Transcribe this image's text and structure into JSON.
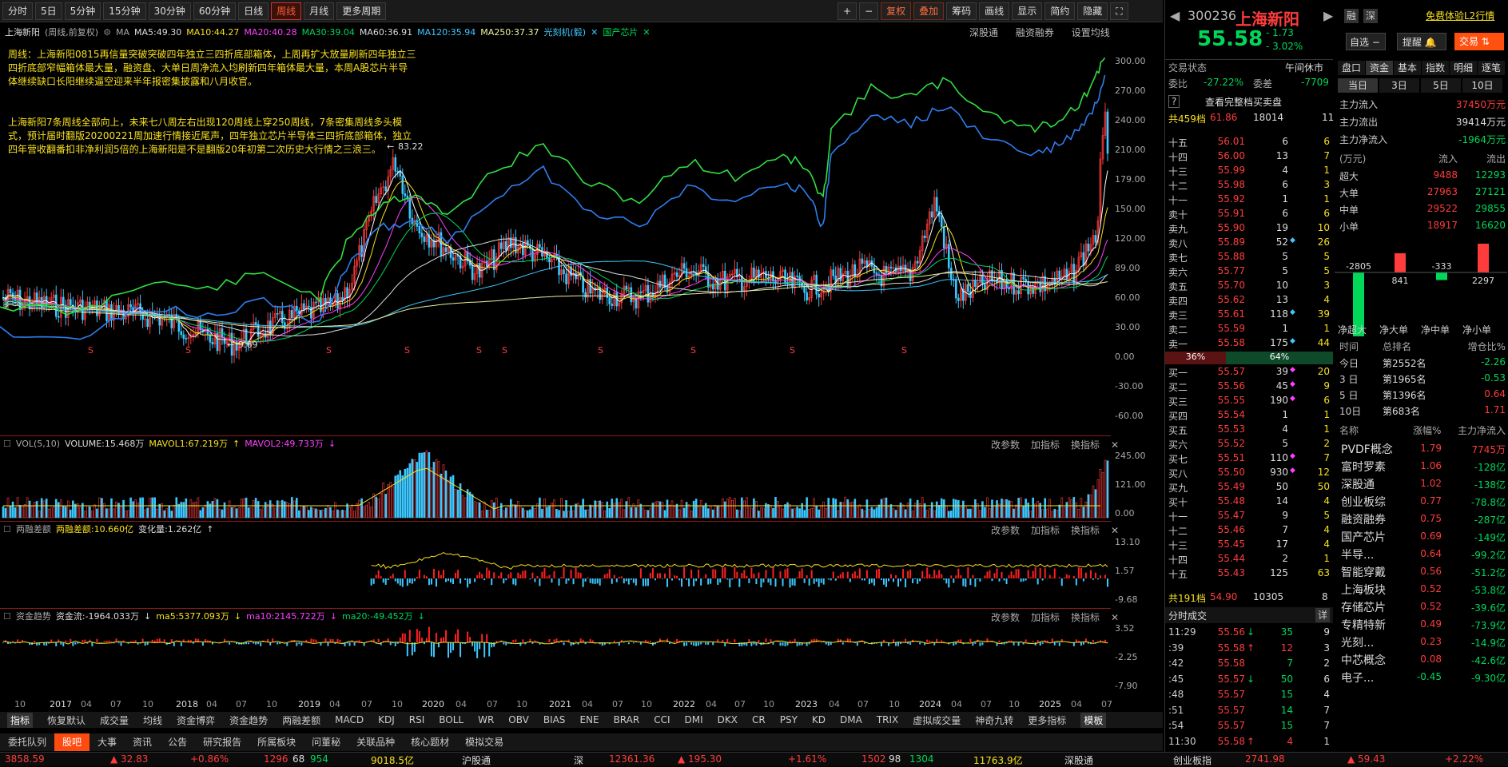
{
  "toolbar": {
    "items": [
      "分时",
      "5日",
      "5分钟",
      "15分钟",
      "30分钟",
      "60分钟",
      "日线",
      "周线",
      "月线",
      "更多周期"
    ],
    "active": "周线",
    "right_items": [
      "+",
      "−",
      "复权",
      "叠加",
      "筹码",
      "画线",
      "显示",
      "简约",
      "隐藏"
    ]
  },
  "info": {
    "title": "上海新阳",
    "period": "(周线,前复权)",
    "ma_label": "MA",
    "ma5": "MA5:49.30",
    "ma10": "MA10:44.27",
    "ma20": "MA20:40.28",
    "ma30": "MA30:39.04",
    "ma60": "MA60:36.91",
    "ma120": "MA120:35.94",
    "ma250": "MA250:37.37",
    "overlay1": "光刻机(毅)",
    "overlay2": "国产芯片",
    "right_links": [
      "深股通",
      "融资融券",
      "设置均线"
    ]
  },
  "notes": {
    "p1": "周线：上海新阳0815再信量突破突破四年独立三四折底部箱体，上周再扩大放量刷新四年独立三四折底部窄幅箱体最大量，融资盘、大单日周净流入均刷新四年箱体最大量，本周A股芯片半导体继续缺口长阳继续逼空迎来半年报密集披露和八月收官。",
    "p2": "上海新阳7条周线全部向上，未来七八周左右出现120周线上穿250周线，7条密集周线多头模式，预计届时翻版20200221周加速行情接近尾声，四年独立芯片半导体三四折底部箱体，独立四年营收翻番扣非净利润5倍的上海新阳是不是翻版20年初第二次历史大行情之三浪三。"
  },
  "main_axis": [
    "300.00",
    "270.00",
    "240.00",
    "210.00",
    "179.00",
    "150.00",
    "120.00",
    "89.00",
    "60.00",
    "30.00",
    "0.00",
    "-30.00",
    "-60.00"
  ],
  "annotations": {
    "high": "83.22",
    "low": "9.69"
  },
  "vol": {
    "name": "VOL(5,10)",
    "volume": "VOLUME:15.468万",
    "mavol1": "MAVOL1:67.219万",
    "mavol2": "MAVOL2:49.733万",
    "axis": [
      "245.00",
      "121.00",
      "0.00"
    ]
  },
  "margin": {
    "name": "两融差额",
    "v1": "两融差额:10.660亿",
    "v2": "变化量:1.262亿",
    "axis": [
      "13.10",
      "1.57",
      "-9.68"
    ]
  },
  "fund": {
    "name": "资金趋势",
    "v1": "资金流:-1964.033万",
    "v2": "ma5:5377.093万",
    "v3": "ma10:2145.722万",
    "v4": "ma20:-49.452万",
    "axis": [
      "3.52",
      "-2.25",
      "-7.90"
    ]
  },
  "panel_btns": [
    "改参数",
    "加指标",
    "换指标"
  ],
  "xaxis": [
    "10",
    "2017",
    "04",
    "07",
    "10",
    "2018",
    "04",
    "07",
    "10",
    "2019",
    "04",
    "07",
    "10",
    "2020",
    "04",
    "07",
    "10",
    "2021",
    "04",
    "07",
    "10",
    "2022",
    "04",
    "07",
    "10",
    "2023",
    "04",
    "07",
    "10",
    "2024",
    "04",
    "07",
    "10",
    "2025",
    "04",
    "07"
  ],
  "tabs1": [
    "指标",
    "恢复默认",
    "成交量",
    "均线",
    "资金博弈",
    "资金趋势",
    "两融差额",
    "MACD",
    "KDJ",
    "RSI",
    "BOLL",
    "WR",
    "OBV",
    "BIAS",
    "ENE",
    "BRAR",
    "CCI",
    "DMI",
    "DKX",
    "CR",
    "PSY",
    "KD",
    "DMA",
    "TRIX",
    "虚拟成交量",
    "神奇九转",
    "更多指标",
    "模板"
  ],
  "tabs2": [
    "委托队列",
    "股吧",
    "大事",
    "资讯",
    "公告",
    "研究报告",
    "所属板块",
    "问董秘",
    "关联品种",
    "核心题材",
    "模拟交易"
  ],
  "tabs2_active": "股吧",
  "status": {
    "sh": "3858.59",
    "sh_chg": "▲ 32.83",
    "sh_pct": "+0.86%",
    "sh_c1": "1296",
    "sh_c2": "68",
    "sh_c3": "954",
    "sh_amt": "9018.5亿",
    "hgt": "沪股通",
    "hgt_v": "▲ 195.30",
    "sz": "12361.36",
    "sz_pct": "+1.61%",
    "sz_c1": "1502",
    "sz_c2": "98",
    "sz_c3": "1304",
    "sz_amt": "11763.9亿",
    "sgt": "深股通",
    "cyb": "创业板指",
    "cyb_v": "2741.98",
    "cyb_chg": "▲ 59.43",
    "cyb_pct": "+2.22%"
  },
  "stock": {
    "code": "300236",
    "name": "上海新阳",
    "price": "55.58",
    "chg": "- 1.73",
    "pct": "- 3.02%",
    "badges": [
      "融",
      "深"
    ],
    "promo": "免费体验L2行情",
    "btn1": "自选",
    "btn2": "提醒",
    "btn3": "交易"
  },
  "trade_state": {
    "label": "交易状态",
    "value": "午间休市",
    "wb_label": "委比",
    "wb": "-27.22%",
    "wc_label": "委差",
    "wc": "-7709",
    "full": "查看完整档买卖盘",
    "total_sell": "共459档",
    "ts_price": "61.86",
    "ts_vol": "18014",
    "ts_n": "11"
  },
  "sells": [
    [
      "十五",
      "56.01",
      "6",
      "6"
    ],
    [
      "十四",
      "56.00",
      "13",
      "7"
    ],
    [
      "十三",
      "55.99",
      "4",
      "1"
    ],
    [
      "十二",
      "55.98",
      "6",
      "3"
    ],
    [
      "十一",
      "55.92",
      "1",
      "1"
    ],
    [
      "卖十",
      "55.91",
      "6",
      "6"
    ],
    [
      "卖九",
      "55.90",
      "19",
      "10"
    ],
    [
      "卖八",
      "55.89",
      "52",
      "26"
    ],
    [
      "卖七",
      "55.88",
      "5",
      "5"
    ],
    [
      "卖六",
      "55.77",
      "5",
      "5"
    ],
    [
      "卖五",
      "55.70",
      "10",
      "3"
    ],
    [
      "卖四",
      "55.62",
      "13",
      "4"
    ],
    [
      "卖三",
      "55.61",
      "118",
      "39"
    ],
    [
      "卖二",
      "55.59",
      "1",
      "1"
    ],
    [
      "卖一",
      "55.58",
      "175",
      "44"
    ]
  ],
  "ratio": {
    "buy": "36%",
    "sell": "64%"
  },
  "buys": [
    [
      "买一",
      "55.57",
      "39",
      "20"
    ],
    [
      "买二",
      "55.56",
      "45",
      "9"
    ],
    [
      "买三",
      "55.55",
      "190",
      "6"
    ],
    [
      "买四",
      "55.54",
      "1",
      "1"
    ],
    [
      "买五",
      "55.53",
      "4",
      "1"
    ],
    [
      "买六",
      "55.52",
      "5",
      "2"
    ],
    [
      "买七",
      "55.51",
      "110",
      "7"
    ],
    [
      "买八",
      "55.50",
      "930",
      "12"
    ],
    [
      "买九",
      "55.49",
      "50",
      "50"
    ],
    [
      "买十",
      "55.48",
      "14",
      "4"
    ],
    [
      "十一",
      "55.47",
      "9",
      "5"
    ],
    [
      "十二",
      "55.46",
      "7",
      "4"
    ],
    [
      "十三",
      "55.45",
      "17",
      "4"
    ],
    [
      "十四",
      "55.44",
      "2",
      "1"
    ],
    [
      "十五",
      "55.43",
      "125",
      "63"
    ]
  ],
  "total_buy": {
    "label": "共191档",
    "price": "54.90",
    "vol": "10305",
    "n": "8"
  },
  "ticks_title": "分时成交",
  "ticks_btn": "详",
  "ticks": [
    [
      "11:29",
      "55.56",
      "↓",
      "35",
      "9"
    ],
    [
      ":39",
      "55.58",
      "↑",
      "12",
      "3"
    ],
    [
      ":42",
      "55.58",
      "",
      "7",
      "2"
    ],
    [
      ":45",
      "55.57",
      "↓",
      "50",
      "6"
    ],
    [
      ":48",
      "55.57",
      "",
      "15",
      "4"
    ],
    [
      ":51",
      "55.57",
      "",
      "14",
      "7"
    ],
    [
      ":54",
      "55.57",
      "",
      "15",
      "7"
    ],
    [
      "11:30",
      "55.58",
      "↑",
      "4",
      "1"
    ]
  ],
  "fundtabs": [
    "盘口",
    "资金",
    "基本",
    "指数",
    "明细",
    "逐笔"
  ],
  "daytabs": [
    "当日",
    "3日",
    "5日",
    "10日"
  ],
  "flow": {
    "in_label": "主力流入",
    "in": "37450万元",
    "out_label": "主力流出",
    "out": "39414万元",
    "net_label": "主力净流入",
    "net": "-1964万元"
  },
  "flow_tbl": {
    "h0": "(万元)",
    "h1": "流入",
    "h2": "流出",
    "rows": [
      [
        "超大",
        "9488",
        "12293"
      ],
      [
        "大单",
        "27963",
        "27121"
      ],
      [
        "中单",
        "29522",
        "29855"
      ],
      [
        "小单",
        "18917",
        "16620"
      ]
    ]
  },
  "net_bars": {
    "labels": [
      "净超大",
      "净大单",
      "净中单",
      "净小单"
    ],
    "values": [
      "-2805",
      "841",
      "-333",
      "2297"
    ],
    "nums": [
      -2805,
      841,
      -333,
      2297
    ]
  },
  "rank": {
    "h0": "时间",
    "h1": "总排名",
    "h2": "增仓比%",
    "rows": [
      [
        "今日",
        "第2552名",
        "-2.26"
      ],
      [
        "3 日",
        "第1965名",
        "-0.53"
      ],
      [
        "5 日",
        "第1396名",
        "0.64"
      ],
      [
        "10日",
        "第683名",
        "1.71"
      ]
    ]
  },
  "sectors": {
    "h0": "名称",
    "h1": "涨幅%",
    "h2": "主力净流入",
    "rows": [
      [
        "PVDF概念",
        "1.79",
        "7745万"
      ],
      [
        "富时罗素",
        "1.06",
        "-128亿"
      ],
      [
        "深股通",
        "1.02",
        "-138亿"
      ],
      [
        "创业板综",
        "0.77",
        "-78.8亿"
      ],
      [
        "融资融券",
        "0.75",
        "-287亿"
      ],
      [
        "国产芯片",
        "0.69",
        "-149亿"
      ],
      [
        "半导...",
        "0.64",
        "-99.2亿"
      ],
      [
        "智能穿戴",
        "0.56",
        "-51.2亿"
      ],
      [
        "上海板块",
        "0.52",
        "-53.8亿"
      ],
      [
        "存储芯片",
        "0.52",
        "-39.6亿"
      ],
      [
        "专精特新",
        "0.49",
        "-73.9亿"
      ],
      [
        "光刻...",
        "0.23",
        "-14.9亿"
      ],
      [
        "中芯概念",
        "0.08",
        "-42.6亿"
      ],
      [
        "电子...",
        "-0.45",
        "-9.30亿"
      ]
    ]
  }
}
